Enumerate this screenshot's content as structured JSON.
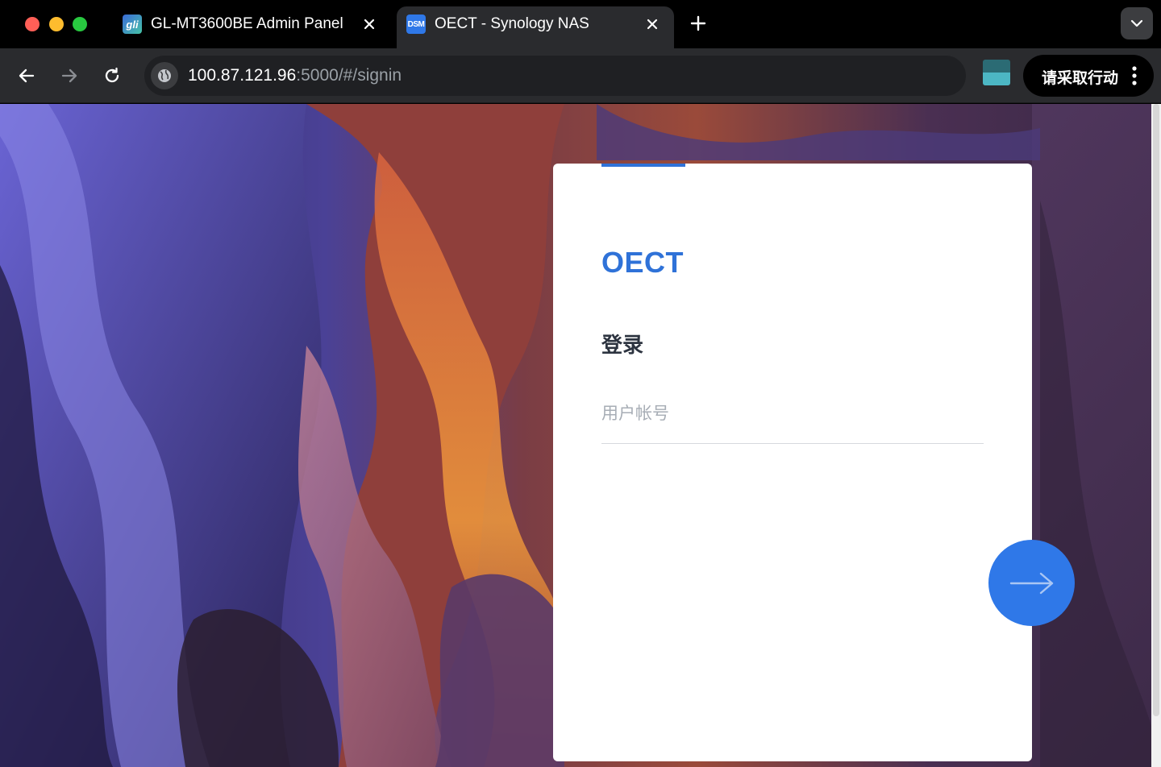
{
  "browser": {
    "tabs": [
      {
        "title": "GL-MT3600BE Admin Panel",
        "favicon_text": "gli",
        "active": false
      },
      {
        "title": "OECT - Synology NAS",
        "favicon_text": "DSM",
        "active": true
      }
    ],
    "url": {
      "host": "100.87.121.96",
      "rest": ":5000/#/signin"
    },
    "action_label": "请采取行动",
    "icons": [
      "back-icon",
      "forward-icon",
      "reload-icon",
      "site-info-icon",
      "new-tab-icon",
      "tab-menu-chevron-icon",
      "kebab-menu-icon",
      "close-icon"
    ]
  },
  "login": {
    "brand": "OECT",
    "heading": "登录",
    "username_placeholder": "用户帐号",
    "username_value": ""
  },
  "colors": {
    "accent": "#2f72d8",
    "button": "#2f78e8",
    "traffic_red": "#ff5f57",
    "traffic_yellow": "#febc2e",
    "traffic_green": "#28c840"
  }
}
